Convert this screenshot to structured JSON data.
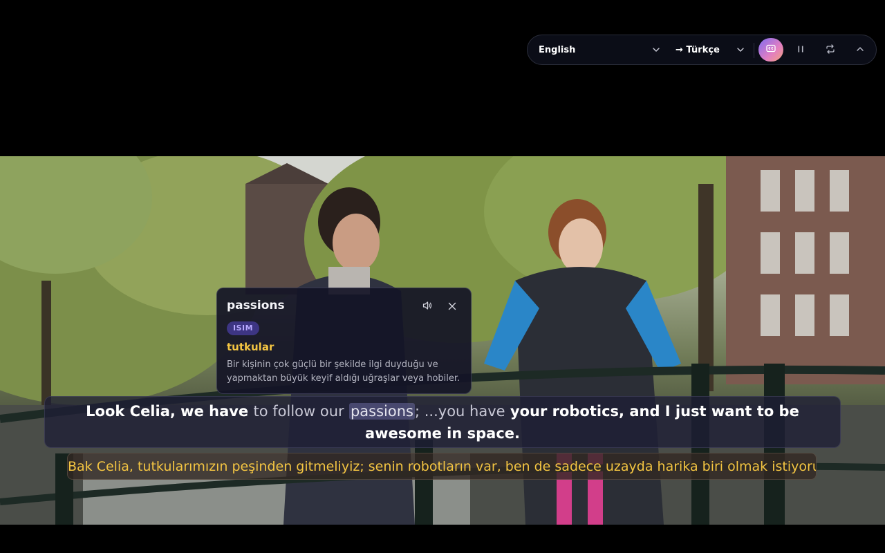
{
  "controls": {
    "source_language": "English",
    "target_language": "→ Türkçe",
    "icons": {
      "source_chevron": "chevron-down-icon",
      "target_chevron": "chevron-down-icon",
      "captions": "closed-captions-icon",
      "pause": "pause-icon",
      "swap": "swap-icon",
      "collapse": "chevron-up-icon"
    },
    "accent_gradient": [
      "#7e6cf0",
      "#e27ec2",
      "#f1a27a"
    ]
  },
  "popup": {
    "word": "passions",
    "part_of_speech": "ISIM",
    "translation": "tutkular",
    "definition": "Bir kişinin çok güçlü bir şekilde ilgi duyduğu ve yapmaktan büyük keyif aldığı uğraşlar veya hobiler.",
    "icons": {
      "speak": "speaker-icon",
      "close": "close-icon"
    }
  },
  "subtitle": {
    "part1": "Look Celia, we have",
    "part2": "to follow our",
    "highlighted_word": "passions",
    "part3": "; ...you have",
    "part4": "your robotics, and I just want to be awesome in space.",
    "translation": "Bak Celia, tutkularımızın peşinden gitmeliyiz; senin robotların var, ben de sadece uzayda harika biri olmak istiyorum."
  },
  "colors": {
    "subtitle_translation": "#f4c542",
    "popup_translation": "#f4c542",
    "badge_bg": "#3d3583",
    "badge_text": "#b8a9ff"
  }
}
